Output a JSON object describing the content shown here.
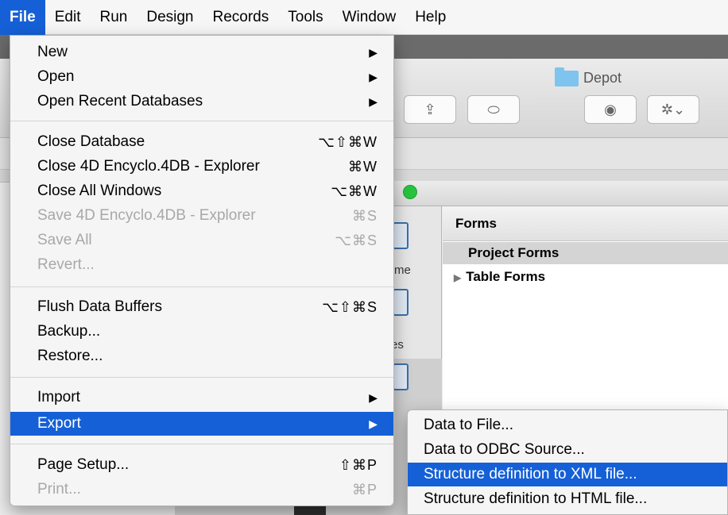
{
  "menubar": {
    "items": [
      "File",
      "Edit",
      "Run",
      "Design",
      "Records",
      "Tools",
      "Window",
      "Help"
    ],
    "active": "File"
  },
  "window": {
    "title": "Depot",
    "forms_header": "Forms",
    "project_forms": "Project Forms",
    "table_forms": "Table Forms",
    "sidebar_fragments": [
      "me",
      "es"
    ]
  },
  "file_menu": {
    "groups": [
      [
        {
          "label": "New",
          "submenu": true
        },
        {
          "label": "Open",
          "submenu": true
        },
        {
          "label": "Open Recent Databases",
          "submenu": true
        }
      ],
      [
        {
          "label": "Close Database",
          "shortcut": "⌥⇧⌘W"
        },
        {
          "label": "Close 4D Encyclo.4DB - Explorer",
          "shortcut": "⌘W"
        },
        {
          "label": "Close All Windows",
          "shortcut": "⌥⌘W"
        },
        {
          "label": "Save 4D Encyclo.4DB - Explorer",
          "shortcut": "⌘S",
          "disabled": true
        },
        {
          "label": "Save All",
          "shortcut": "⌥⌘S",
          "disabled": true
        },
        {
          "label": "Revert...",
          "disabled": true
        }
      ],
      [
        {
          "label": "Flush Data Buffers",
          "shortcut": "⌥⇧⌘S"
        },
        {
          "label": "Backup..."
        },
        {
          "label": "Restore..."
        }
      ],
      [
        {
          "label": "Import",
          "submenu": true
        },
        {
          "label": "Export",
          "submenu": true,
          "highlighted": true
        }
      ],
      [
        {
          "label": "Page Setup...",
          "shortcut": "⇧⌘P"
        },
        {
          "label": "Print...",
          "shortcut": "⌘P",
          "disabled": true
        }
      ]
    ]
  },
  "export_submenu": {
    "items": [
      {
        "label": "Data to File..."
      },
      {
        "label": "Data to ODBC Source..."
      },
      {
        "label": "Structure definition to XML file...",
        "highlighted": true
      },
      {
        "label": "Structure definition to HTML file..."
      }
    ]
  },
  "colors": {
    "highlight": "#1560d6",
    "disabled_text": "#a8a8a8",
    "window_button_green": "#28c33f"
  }
}
